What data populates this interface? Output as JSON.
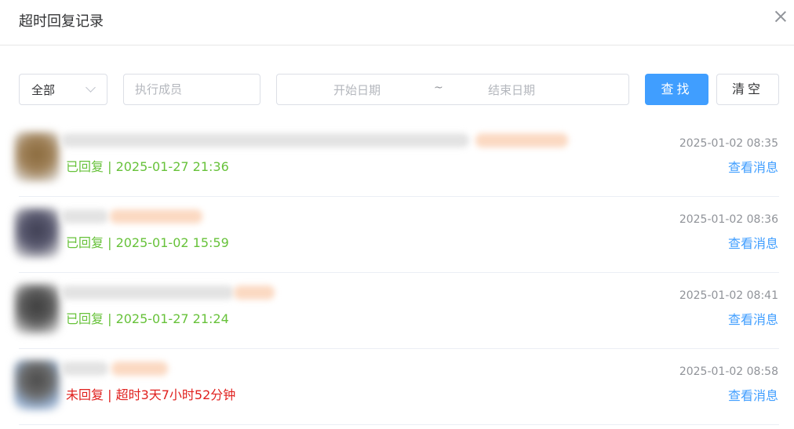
{
  "dialog": {
    "title": "超时回复记录"
  },
  "filters": {
    "status_value": "全部",
    "member_placeholder": "执行成员",
    "start_placeholder": "开始日期",
    "range_separator": "~",
    "end_placeholder": "结束日期",
    "search_label": "查找",
    "clear_label": "清空"
  },
  "records": [
    {
      "status": "已回复 | 2025-01-27 21:36",
      "time": "2025-01-02 08:35",
      "link": "查看消息"
    },
    {
      "status": "已回复 | 2025-01-02 15:59",
      "time": "2025-01-02 08:36",
      "link": "查看消息"
    },
    {
      "status": "已回复 | 2025-01-27 21:24",
      "time": "2025-01-02 08:41",
      "link": "查看消息"
    },
    {
      "status": "未回复 | 超时3天7小时52分钟",
      "time": "2025-01-02 08:58",
      "link": "查看消息"
    }
  ],
  "colors": {
    "primary": "#409eff",
    "replied": "#67c23a",
    "unreplied": "#e0201e"
  }
}
